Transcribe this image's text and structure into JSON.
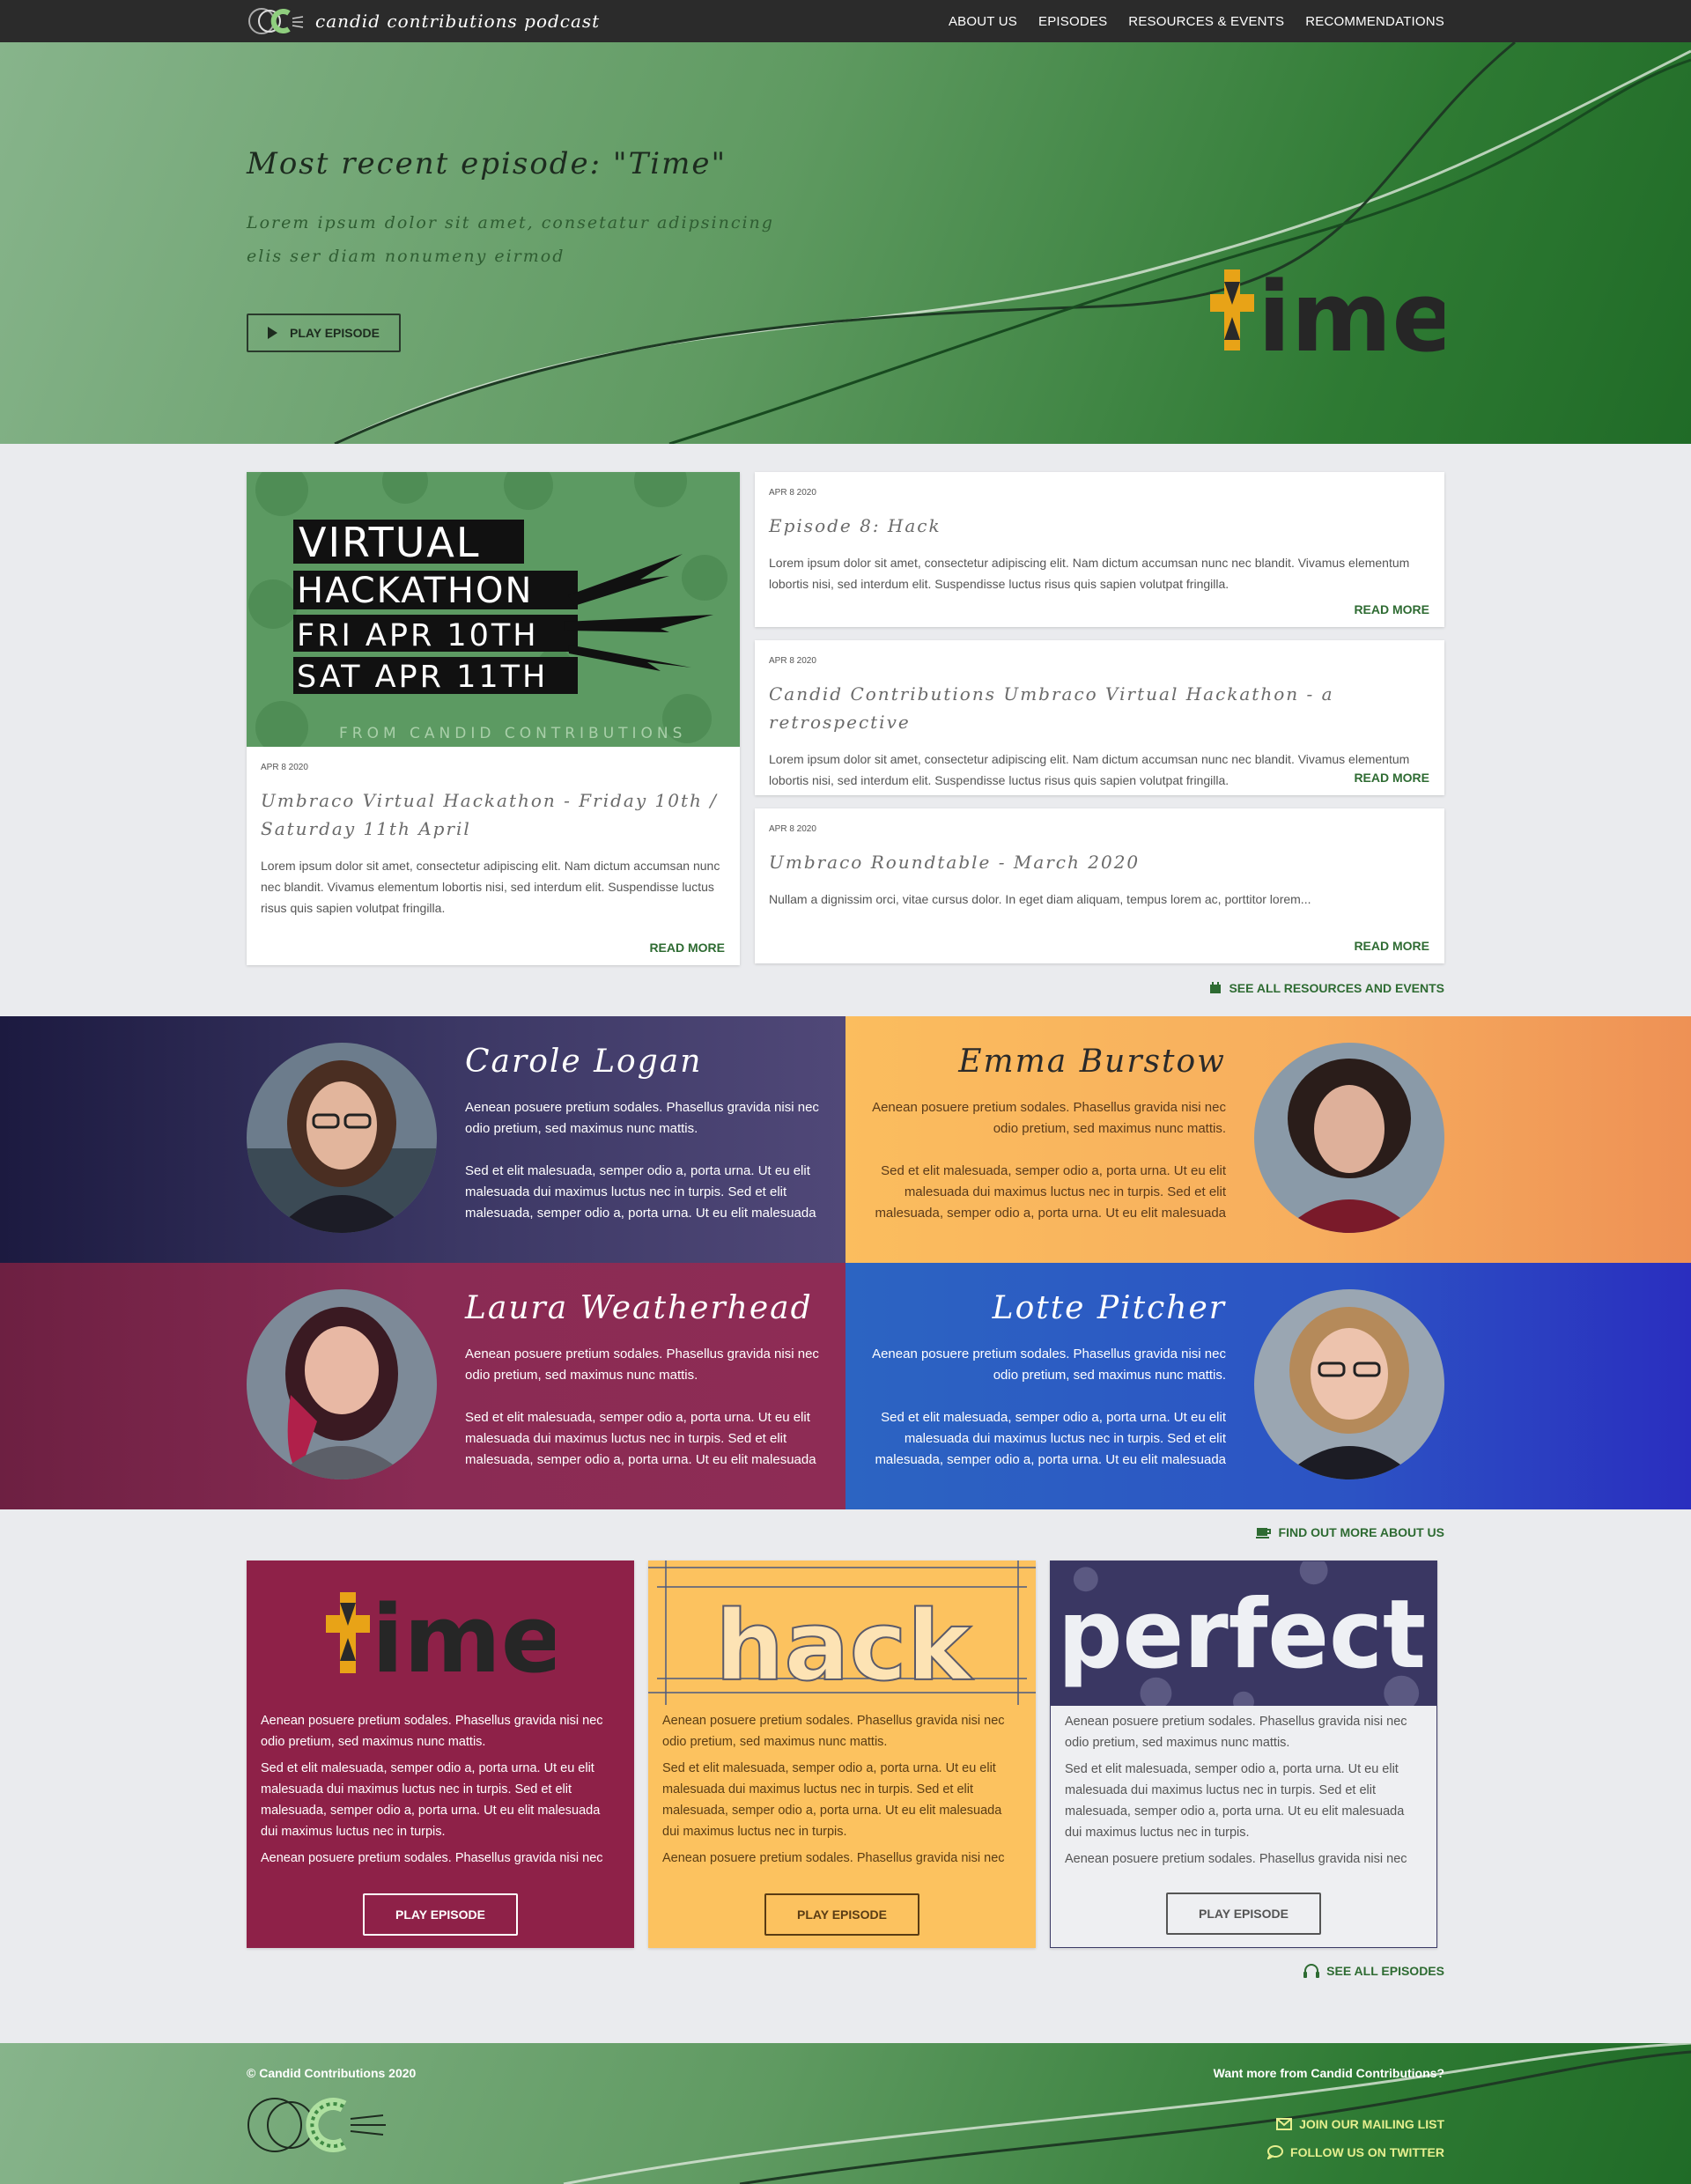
{
  "nav": {
    "brand": "candid contributions podcast",
    "links": [
      "ABOUT US",
      "EPISODES",
      "RESOURCES & EVENTS",
      "RECOMMENDATIONS"
    ]
  },
  "hero": {
    "title": "Most recent episode: \"Time\"",
    "text": "Lorem ipsum dolor sit amet, consetatur adipsincing elis ser diam nonumeny eirmod",
    "button": "PLAY EPISODE",
    "logo_word": "ime"
  },
  "featured": {
    "banner": [
      "VIRTUAL",
      "HACKATHON",
      "FRI APR 10TH",
      "SAT APR 11TH"
    ],
    "banner_footer": "FROM CANDID CONTRIBUTIONS",
    "date": "APR 8 2020",
    "title": "Umbraco Virtual Hackathon - Friday 10th / Saturday 11th April",
    "text": "Lorem ipsum dolor sit amet, consectetur adipiscing elit. Nam dictum accumsan nunc nec blandit. Vivamus elementum lobortis nisi, sed interdum elit. Suspendisse luctus risus quis sapien volutpat fringilla.",
    "readmore": "READ MORE"
  },
  "posts": [
    {
      "date": "APR 8 2020",
      "title": "Episode 8: Hack",
      "text": "Lorem ipsum dolor sit amet, consectetur adipiscing elit. Nam dictum accumsan nunc nec blandit. Vivamus elementum lobortis nisi, sed interdum elit. Suspendisse luctus risus quis sapien volutpat fringilla.",
      "readmore": "READ MORE"
    },
    {
      "date": "APR 8 2020",
      "title": "Candid Contributions Umbraco Virtual Hackathon - a retrospective",
      "text": "Lorem ipsum dolor sit amet, consectetur adipiscing elit. Nam dictum accumsan nunc nec blandit. Vivamus elementum lobortis nisi, sed interdum elit. Suspendisse luctus risus quis sapien volutpat fringilla.",
      "readmore": "READ MORE"
    },
    {
      "date": "APR 8 2020",
      "title": "Umbraco Roundtable - March 2020",
      "text": "Nullam a dignissim orci, vitae cursus dolor. In eget diam aliquam, tempus lorem ac, porttitor lorem...",
      "readmore": "READ MORE"
    }
  ],
  "see_all_resources": "SEE ALL RESOURCES AND EVENTS",
  "people": [
    {
      "name": "Carole Logan",
      "p1": "Aenean posuere pretium sodales. Phasellus gravida nisi nec odio pretium, sed maximus nunc mattis.",
      "p2": "Sed et elit malesuada, semper odio a, porta urna. Ut eu elit malesuada dui maximus luctus nec in turpis. Sed et elit malesuada, semper odio a, porta urna. Ut eu elit malesuada"
    },
    {
      "name": "Emma Burstow",
      "p1": "Aenean posuere pretium sodales. Phasellus gravida nisi nec odio pretium, sed maximus nunc mattis.",
      "p2": "Sed et elit malesuada, semper odio a, porta urna. Ut eu elit malesuada dui maximus luctus nec in turpis. Sed et elit malesuada, semper odio a, porta urna. Ut eu elit malesuada"
    },
    {
      "name": "Laura Weatherhead",
      "p1": "Aenean posuere pretium sodales. Phasellus gravida nisi nec odio pretium, sed maximus nunc mattis.",
      "p2": "Sed et elit malesuada, semper odio a, porta urna. Ut eu elit malesuada dui maximus luctus nec in turpis. Sed et elit malesuada, semper odio a, porta urna. Ut eu elit malesuada"
    },
    {
      "name": "Lotte Pitcher",
      "p1": "Aenean posuere pretium sodales. Phasellus gravida nisi nec odio pretium, sed maximus nunc mattis.",
      "p2": "Sed et elit malesuada, semper odio a, porta urna. Ut eu elit malesuada dui maximus luctus nec in turpis. Sed et elit malesuada, semper odio a, porta urna. Ut eu elit malesuada"
    }
  ],
  "find_out_more": "FIND OUT MORE ABOUT US",
  "episodes": [
    {
      "art_word": "ime",
      "p1": "Aenean posuere pretium sodales. Phasellus gravida nisi nec odio pretium, sed maximus nunc mattis.",
      "p2": "Sed et elit malesuada, semper odio a, porta urna. Ut eu elit malesuada dui maximus luctus nec in turpis. Sed et elit malesuada, semper odio a, porta urna. Ut eu elit malesuada dui maximus luctus nec in turpis.",
      "p3": "Aenean posuere pretium sodales. Phasellus gravida nisi nec",
      "button": "PLAY EPISODE"
    },
    {
      "art_word": "hack",
      "p1": "Aenean posuere pretium sodales. Phasellus gravida nisi nec odio pretium, sed maximus nunc mattis.",
      "p2": "Sed et elit malesuada, semper odio a, porta urna. Ut eu elit malesuada dui maximus luctus nec in turpis. Sed et elit malesuada, semper odio a, porta urna. Ut eu elit malesuada dui maximus luctus nec in turpis.",
      "p3": "Aenean posuere pretium sodales. Phasellus gravida nisi nec",
      "button": "PLAY EPISODE"
    },
    {
      "art_word": "perfect",
      "p1": "Aenean posuere pretium sodales. Phasellus gravida nisi nec odio pretium, sed maximus nunc mattis.",
      "p2": "Sed et elit malesuada, semper odio a, porta urna. Ut eu elit malesuada dui maximus luctus nec in turpis. Sed et elit malesuada, semper odio a, porta urna. Ut eu elit malesuada dui maximus luctus nec in turpis.",
      "p3": "Aenean posuere pretium sodales. Phasellus gravida nisi nec",
      "button": "PLAY EPISODE"
    }
  ],
  "see_all_episodes": "SEE ALL EPISODES",
  "footer": {
    "copyright": "© Candid Contributions 2020",
    "want_more": "Want more from Candid Contributions?",
    "mailing": "JOIN OUR MAILING LIST",
    "twitter": "FOLLOW US ON TWITTER"
  },
  "colors": {
    "green_accent": "#2e6b32",
    "hero_dark": "#206b27",
    "purple": "#3c3865",
    "orange": "#fbbd5e",
    "maroon": "#8e2148",
    "blue": "#2c53c4"
  },
  "icons": [
    "logo-icon",
    "play-icon",
    "calendar-icon",
    "coffee-cup-icon",
    "headphones-icon",
    "mail-icon",
    "chat-bubble-icon"
  ]
}
